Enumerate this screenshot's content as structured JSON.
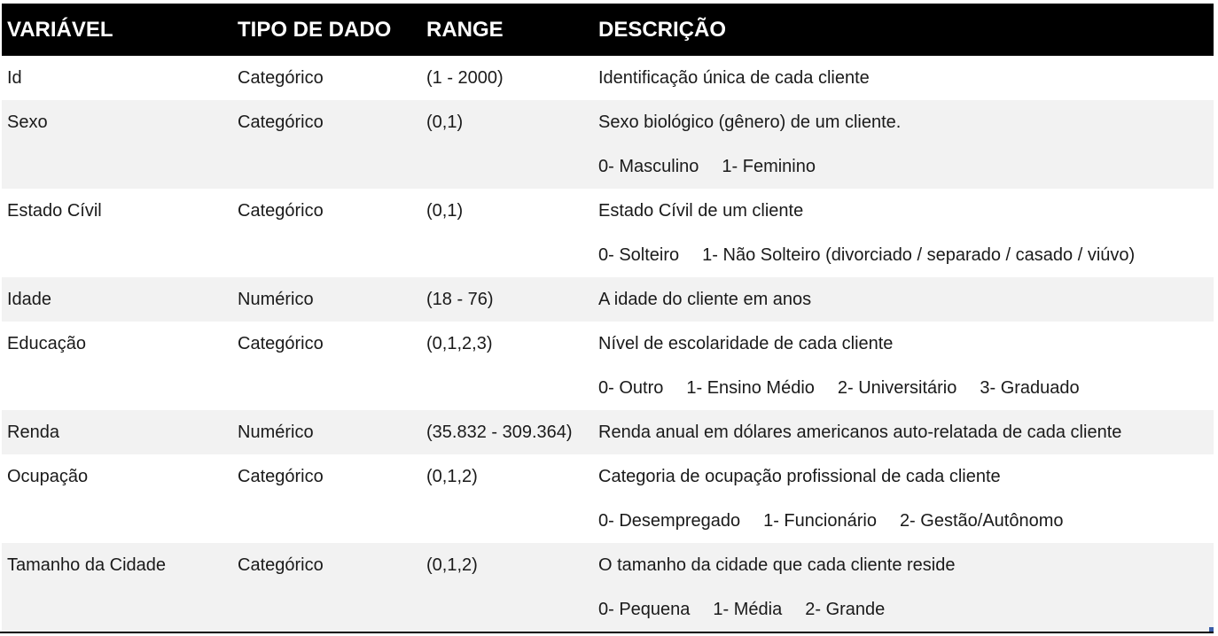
{
  "table": {
    "headers": {
      "variavel": "VARIÁVEL",
      "tipo": "TIPO DE DADO",
      "range": "RANGE",
      "descricao": "DESCRIÇÃO"
    },
    "rows": [
      {
        "variavel": "Id",
        "tipo": "Categórico",
        "range": "(1 - 2000)",
        "descricao": "Identificação única de cada cliente",
        "options": []
      },
      {
        "variavel": "Sexo",
        "tipo": "Categórico",
        "range": "(0,1)",
        "descricao": "Sexo biológico (gênero) de um cliente.",
        "options": [
          "0- Masculino",
          "1- Feminino"
        ]
      },
      {
        "variavel": "Estado Cívil",
        "tipo": "Categórico",
        "range": "(0,1)",
        "descricao": "Estado Cívil de um cliente",
        "options": [
          "0- Solteiro",
          "1- Não Solteiro (divorciado / separado / casado / viúvo)"
        ]
      },
      {
        "variavel": "Idade",
        "tipo": "Numérico",
        "range": "(18 - 76)",
        "descricao": "A idade do cliente em anos",
        "options": []
      },
      {
        "variavel": "Educação",
        "tipo": "Categórico",
        "range": "(0,1,2,3)",
        "descricao": "Nível de escolaridade de cada cliente",
        "options": [
          "0- Outro",
          "1- Ensino Médio",
          "2- Universitário",
          "3- Graduado"
        ]
      },
      {
        "variavel": "Renda",
        "tipo": "Numérico",
        "range": "(35.832 - 309.364)",
        "descricao": "Renda anual em dólares americanos auto-relatada de cada cliente",
        "options": []
      },
      {
        "variavel": "Ocupação",
        "tipo": "Categórico",
        "range": "(0,1,2)",
        "descricao": "Categoria de ocupação profissional de cada cliente",
        "options": [
          "0- Desempregado",
          "1- Funcionário",
          "2- Gestão/Autônomo"
        ]
      },
      {
        "variavel": "Tamanho da Cidade",
        "tipo": "Categórico",
        "range": "(0,1,2)",
        "descricao": "O tamanho da cidade que cada cliente reside",
        "options": [
          "0- Pequena",
          "1- Média",
          "2- Grande"
        ]
      }
    ]
  },
  "colors": {
    "header_bg": "#000000",
    "header_text": "#ffffff",
    "row_shade": "#f2f2f2",
    "text": "#1a1a1a"
  }
}
